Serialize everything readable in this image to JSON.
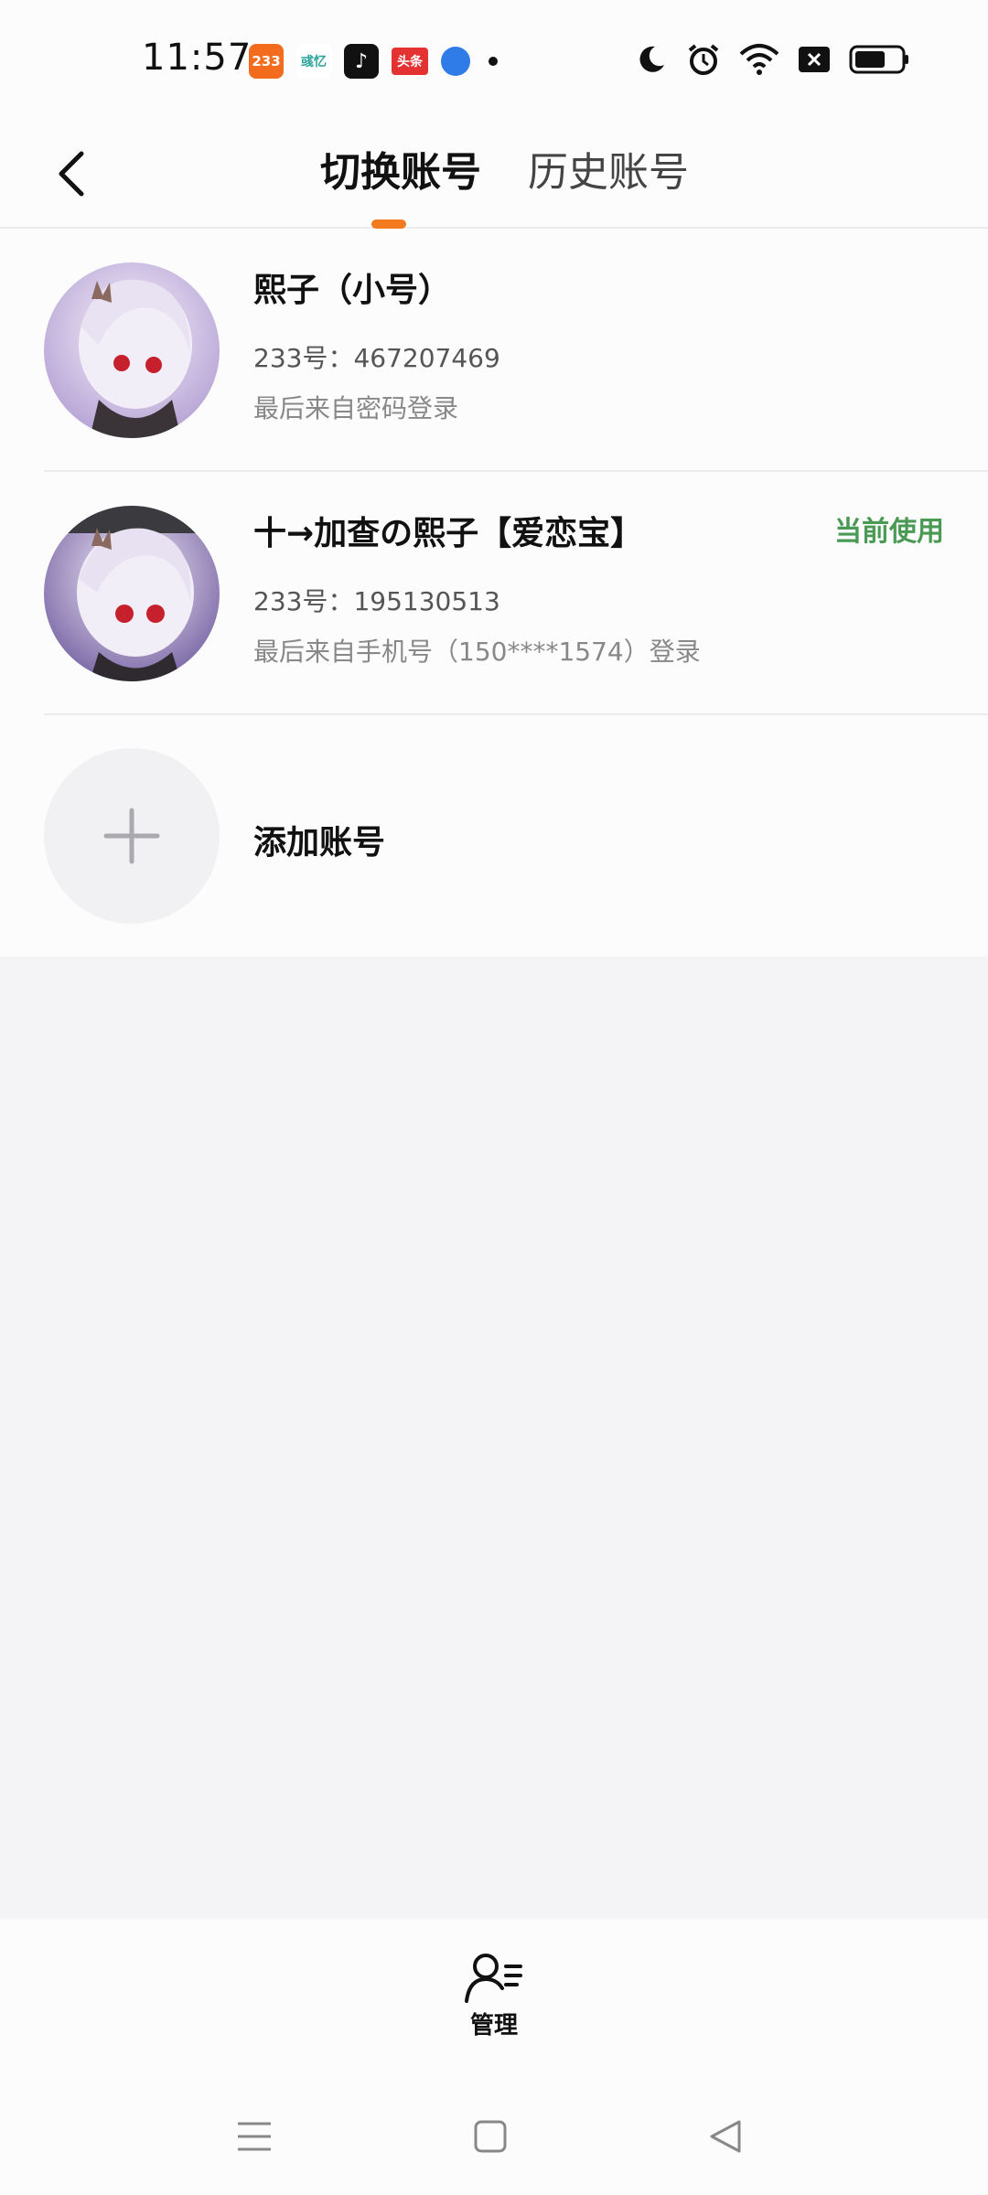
{
  "status_bar": {
    "time": "11:57",
    "notifications": {
      "app_233": "233",
      "wx": "彧忆",
      "tiktok": "♪",
      "toutiao": "头条"
    }
  },
  "header": {
    "tabs": [
      {
        "label": "切换账号",
        "active": true
      },
      {
        "label": "历史账号",
        "active": false
      }
    ],
    "accent_color": "#f47a20"
  },
  "accounts": [
    {
      "name": "熙子（小号）",
      "id_line": "233号：467207469",
      "login_line": "最后来自密码登录",
      "current": false,
      "current_label": ""
    },
    {
      "name": "十→加查の熙子【爱恋宝】",
      "id_line": "233号：195130513",
      "login_line": "最后来自手机号（150****1574）登录",
      "current": true,
      "current_label": "当前使用"
    }
  ],
  "add_account": {
    "label": "添加账号"
  },
  "bottom": {
    "manage_label": "管理"
  },
  "colors": {
    "current_badge": "#4a9a55",
    "background": "#f4f3f5"
  }
}
